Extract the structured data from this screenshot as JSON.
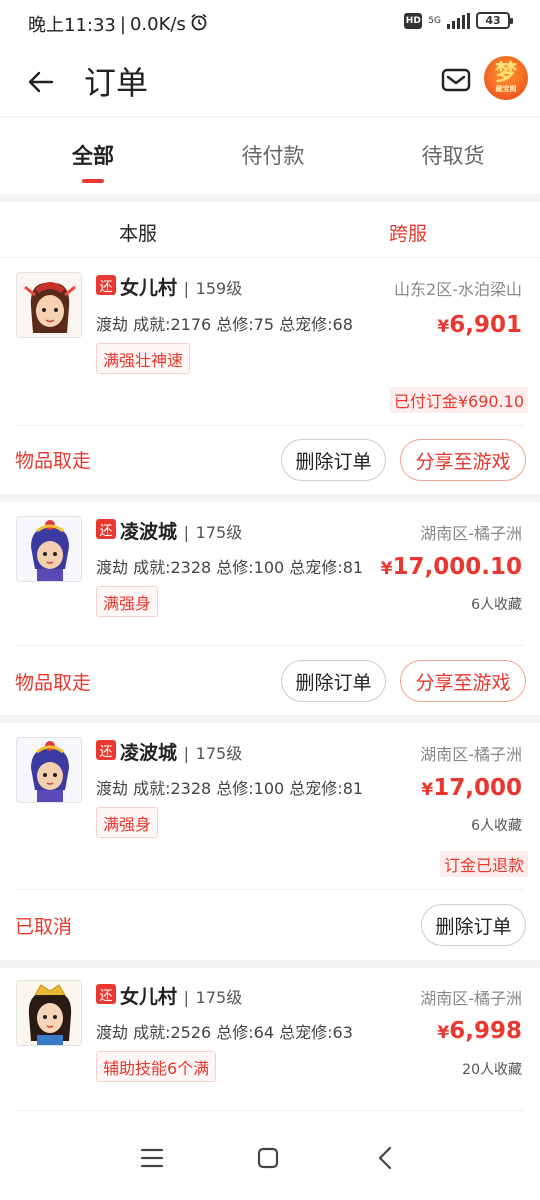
{
  "status_bar": {
    "time": "晚上11:33",
    "speed": "0.0K/s",
    "network": "5G",
    "battery": "43"
  },
  "header": {
    "title": "订单",
    "avatar_text": "梦",
    "avatar_sub": "藏宝阁"
  },
  "tabs": [
    {
      "label": "全部",
      "active": true
    },
    {
      "label": "待付款",
      "active": false
    },
    {
      "label": "待取货",
      "active": false
    }
  ],
  "subtabs": [
    {
      "label": "本服",
      "active": false
    },
    {
      "label": "跨服",
      "active": true
    }
  ],
  "orders": [
    {
      "tag_icon": "还",
      "role": "女儿村",
      "level": "159级",
      "server": "山东2区-水泊梁山",
      "stats": "渡劫 成就:2176 总修:75 总宠修:68",
      "price_symbol": "¥",
      "price": "6,901",
      "tag": "满强壮神速",
      "note": "已付订金¥690.10",
      "status": "物品取走",
      "btn_delete": "删除订单",
      "btn_share": "分享至游戏"
    },
    {
      "tag_icon": "还",
      "role": "凌波城",
      "level": "175级",
      "server": "湖南区-橘子洲",
      "stats": "渡劫 成就:2328 总修:100 总宠修:81",
      "price_symbol": "¥",
      "price": "17,000.10",
      "tag": "满强身",
      "favs": "6人收藏",
      "status": "物品取走",
      "btn_delete": "删除订单",
      "btn_share": "分享至游戏"
    },
    {
      "tag_icon": "还",
      "role": "凌波城",
      "level": "175级",
      "server": "湖南区-橘子洲",
      "stats": "渡劫 成就:2328 总修:100 总宠修:81",
      "price_symbol": "¥",
      "price": "17,000",
      "tag": "满强身",
      "favs": "6人收藏",
      "note": "订金已退款",
      "status": "已取消",
      "btn_delete": "删除订单"
    },
    {
      "tag_icon": "还",
      "role": "女儿村",
      "level": "175级",
      "server": "湖南区-橘子洲",
      "stats": "渡劫 成就:2526 总修:64 总宠修:63",
      "price_symbol": "¥",
      "price": "6,998",
      "tag": "辅助技能6个满",
      "favs": "20人收藏"
    }
  ],
  "colors": {
    "accent": "#e8382f",
    "text": "#222222",
    "muted": "#888888",
    "background": "#f4f4f4"
  }
}
